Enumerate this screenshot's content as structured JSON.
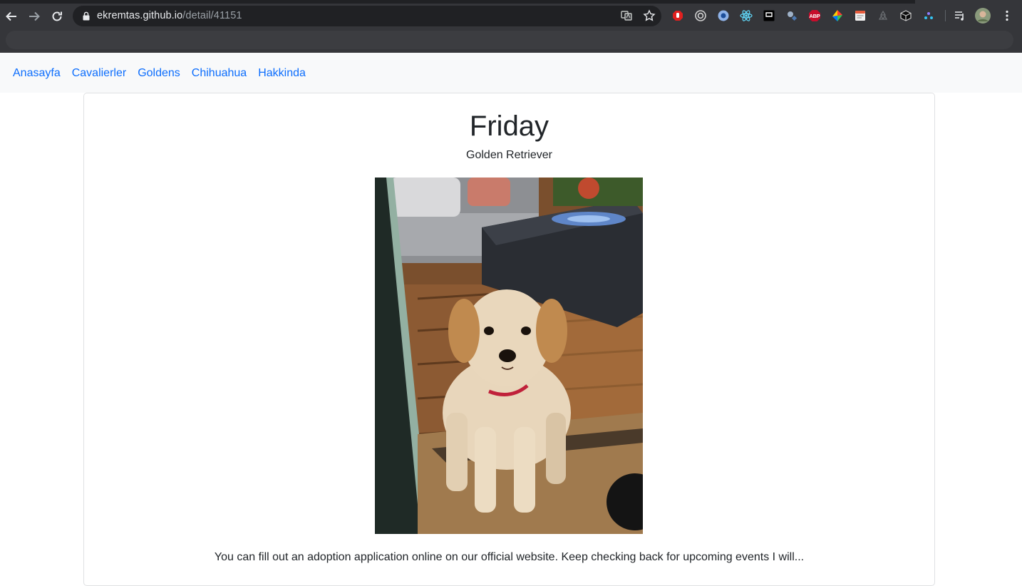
{
  "browser": {
    "url_host": "ekremtas.github.io",
    "url_path": "/detail/41151",
    "extensions": [
      "stop-hand-icon",
      "circle-target-icon",
      "blue-drop-icon",
      "react-icon",
      "pocket-icon",
      "satellite-icon",
      "adblock-plus-icon",
      "color-picker-icon",
      "notes-icon",
      "recycle-icon",
      "cube-icon",
      "dots-icon"
    ],
    "adblock_label": "ABP"
  },
  "nav": {
    "links": [
      "Anasayfa",
      "Cavalierler",
      "Goldens",
      "Chihuahua",
      "Hakkinda"
    ]
  },
  "dog": {
    "name": "Friday",
    "breed": "Golden Retriever",
    "description": "You can fill out an adoption application online on our official website. Keep checking back for upcoming events I will..."
  },
  "colors": {
    "link": "#0d6efd",
    "navbar_bg": "#f8f9fa",
    "chrome_bg": "#35363a"
  }
}
